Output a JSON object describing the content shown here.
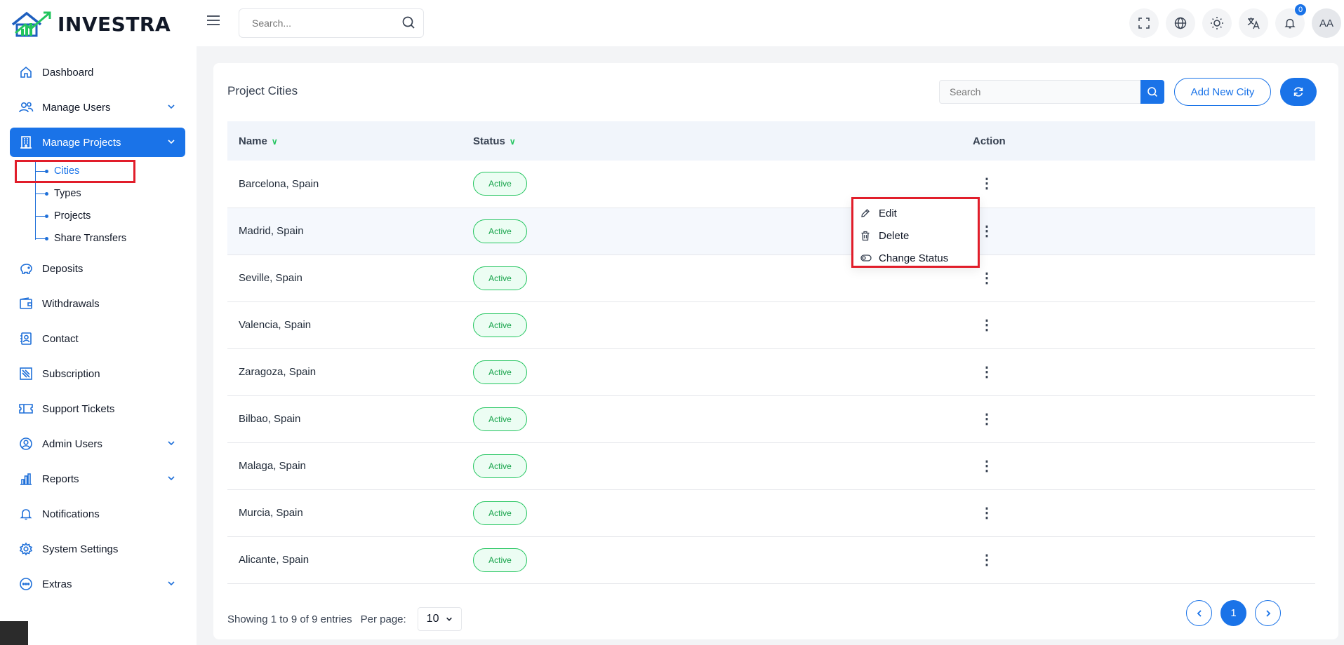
{
  "brand": {
    "name": "INVESTRA"
  },
  "topbar": {
    "search_placeholder": "Search...",
    "notification_count": "0",
    "avatar_initials": "AA"
  },
  "sidebar": {
    "items": [
      {
        "label": "Dashboard",
        "icon": "home-icon"
      },
      {
        "label": "Manage Users",
        "icon": "users-icon"
      },
      {
        "label": "Manage Projects",
        "icon": "building-icon"
      },
      {
        "label": "Deposits",
        "icon": "piggy-bank-icon"
      },
      {
        "label": "Withdrawals",
        "icon": "wallet-icon"
      },
      {
        "label": "Contact",
        "icon": "contact-icon"
      },
      {
        "label": "Subscription",
        "icon": "subscription-icon"
      },
      {
        "label": "Support Tickets",
        "icon": "ticket-icon"
      },
      {
        "label": "Admin Users",
        "icon": "admin-icon"
      },
      {
        "label": "Reports",
        "icon": "chart-icon"
      },
      {
        "label": "Notifications",
        "icon": "bell-icon"
      },
      {
        "label": "System Settings",
        "icon": "gear-icon"
      },
      {
        "label": "Extras",
        "icon": "more-icon"
      }
    ],
    "submenu": [
      "Cities",
      "Types",
      "Projects",
      "Share Transfers"
    ]
  },
  "page": {
    "title": "Project Cities",
    "search_placeholder": "Search",
    "add_label": "Add New City"
  },
  "table": {
    "headers": {
      "name": "Name",
      "status": "Status",
      "action": "Action"
    },
    "rows": [
      {
        "name": "Barcelona, Spain",
        "status": "Active"
      },
      {
        "name": "Madrid, Spain",
        "status": "Active"
      },
      {
        "name": "Seville, Spain",
        "status": "Active"
      },
      {
        "name": "Valencia, Spain",
        "status": "Active"
      },
      {
        "name": "Zaragoza, Spain",
        "status": "Active"
      },
      {
        "name": "Bilbao, Spain",
        "status": "Active"
      },
      {
        "name": "Malaga, Spain",
        "status": "Active"
      },
      {
        "name": "Murcia, Spain",
        "status": "Active"
      },
      {
        "name": "Alicante, Spain",
        "status": "Active"
      }
    ]
  },
  "action_menu": {
    "edit": "Edit",
    "delete": "Delete",
    "change_status": "Change Status"
  },
  "footer": {
    "showing": "Showing 1 to 9 of 9 entries",
    "per_page_label": "Per page:",
    "per_page_value": "10",
    "current_page": "1"
  },
  "colors": {
    "accent": "#1a73e8",
    "success": "#22c55e",
    "highlight": "#e11d2a"
  }
}
